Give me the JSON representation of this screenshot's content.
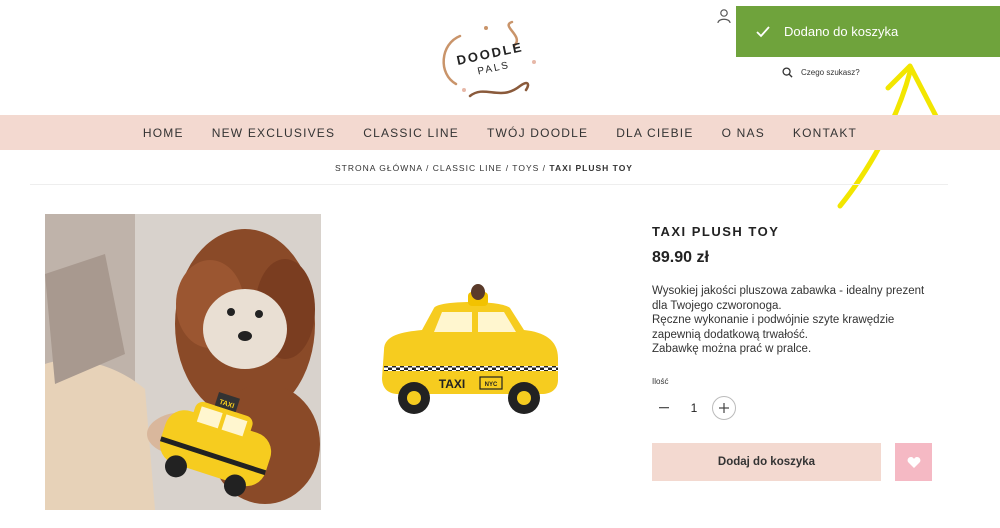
{
  "brand": {
    "logo_text_top": "DOODLE",
    "logo_text_bottom": "PALS"
  },
  "toast": {
    "message": "Dodano do koszyka",
    "color": "#6fa33c"
  },
  "search": {
    "placeholder": "Czego szukasz?"
  },
  "nav": {
    "items": [
      {
        "label": "HOME"
      },
      {
        "label": "NEW EXCLUSIVES"
      },
      {
        "label": "CLASSIC LINE"
      },
      {
        "label": "TWÓJ DOODLE"
      },
      {
        "label": "DLA CIEBIE"
      },
      {
        "label": "O NAS"
      },
      {
        "label": "KONTAKT"
      }
    ]
  },
  "breadcrumb": {
    "items": [
      "STRONA GŁÓWNA",
      "CLASSIC LINE",
      "TOYS"
    ],
    "current": "TAXI PLUSH TOY",
    "separator": " / "
  },
  "product": {
    "title": "TAXI PLUSH TOY",
    "price": "89.90 zł",
    "description": [
      "Wysokiej jakości pluszowa zabawka - idealny prezent",
      "dla Twojego czworonoga.",
      "Ręczne wykonanie i podwójnie szyte krawędzie",
      "zapewnią dodatkową trwałość.",
      "Zabawkę można prać w pralce."
    ],
    "quantity_label": "Ilość",
    "quantity": "1",
    "add_to_cart_label": "Dodaj do koszyka",
    "taxi_sign": "TAXI",
    "taxi_badge": "NYC"
  },
  "colors": {
    "accent_pink": "#f3d9d0",
    "wishlist_pink": "#f5b9c4",
    "arrow_yellow": "#f2e600"
  }
}
